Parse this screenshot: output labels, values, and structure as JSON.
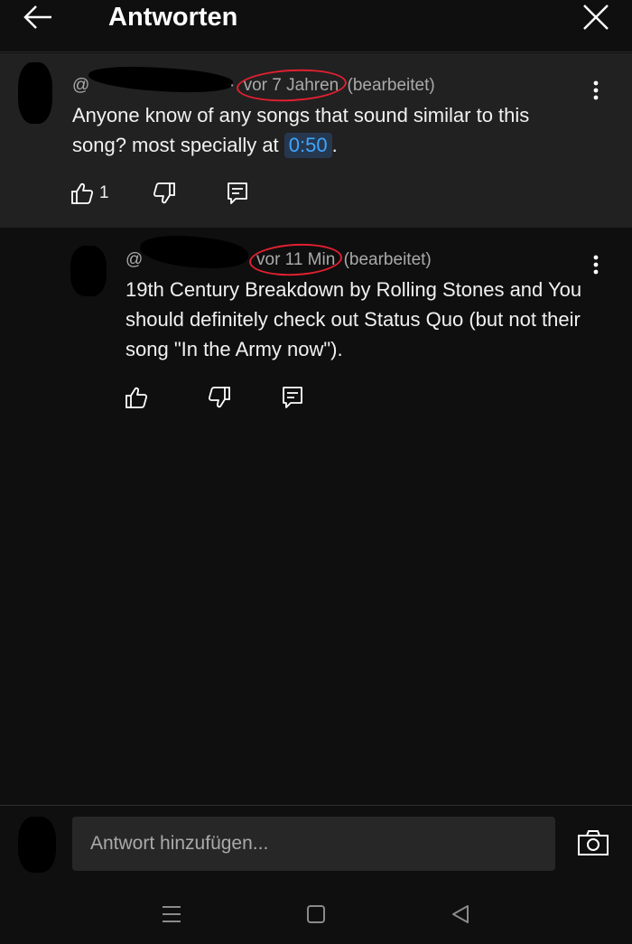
{
  "header": {
    "title": "Antworten",
    "back_icon": "arrow-left-icon",
    "close_icon": "close-icon"
  },
  "parent_comment": {
    "handle_prefix": "@",
    "separator": "·",
    "time": "vor 7 Jahren",
    "edited": "(bearbeitet)",
    "text_before": "Anyone know of any songs that sound similar to this song? most specially at ",
    "timestamp": "0:50",
    "text_after": ".",
    "like_count": "1"
  },
  "reply": {
    "handle_prefix": "@",
    "time": "vor 11 Min",
    "edited": "(bearbeitet)",
    "text": "19th Century Breakdown by Rolling Stones and You should definitely check out Status Quo (but not their song \"In the Army now\")."
  },
  "reply_input": {
    "placeholder": "Antwort hinzufügen..."
  },
  "colors": {
    "background": "#0f0f0f",
    "highlight": "#212121",
    "link": "#3ea6ff",
    "annotation_circle": "#e02030"
  }
}
